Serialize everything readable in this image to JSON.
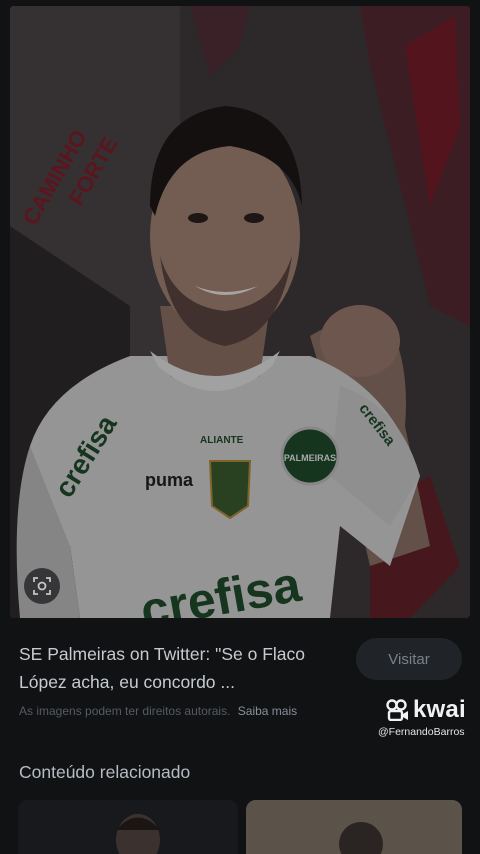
{
  "result": {
    "title": "SE Palmeiras on Twitter: \"Se o Flaco López acha, eu concordo ...",
    "visit_label": "Visitar",
    "rights_text": "As imagens podem ter direitos autorais.",
    "learn_more": "Saiba mais"
  },
  "watermark": {
    "brand": "kwai",
    "user": "@FernandoBarros"
  },
  "related": {
    "heading": "Conteúdo relacionado"
  },
  "image": {
    "wall_text_1": "CAMINHO",
    "wall_text_2": "FORTE",
    "shirt_sponsor": "crefisa",
    "sleeve_sponsor": "crefisa",
    "chest_sponsor": "ALIANTE",
    "crest_text": "PALMEIRAS",
    "collar_brand": "puma"
  },
  "colors": {
    "background": "#101214",
    "accent_red": "#8a1e2c",
    "jersey": "#cfcfcf",
    "jersey_green": "#1f4a2a"
  }
}
